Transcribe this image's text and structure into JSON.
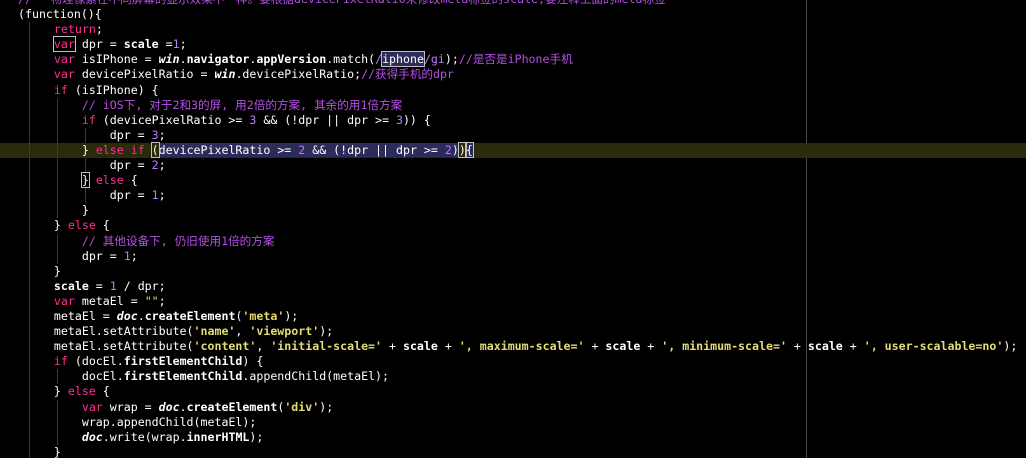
{
  "editor": {
    "lines": [
      {
        "tokens": [
          {
            "t": "// 一物理像素在不同屏幕的显示效果不一样。要根据devicePixelRatio来修改meta标签的scale,要注释上面的meta标签",
            "c": "comment"
          }
        ]
      },
      {
        "tokens": [
          {
            "t": "(function(){",
            "c": "plain"
          }
        ]
      },
      {
        "tokens": [
          {
            "t": "    ",
            "c": "plain"
          },
          {
            "t": "return",
            "c": "keyword"
          },
          {
            "t": ";",
            "c": "plain"
          }
        ]
      },
      {
        "tokens": [
          {
            "t": "    ",
            "c": "plain"
          },
          {
            "t": "var",
            "c": "keyword mark"
          },
          {
            "t": " dpr = ",
            "c": "plain"
          },
          {
            "t": "scale",
            "c": "plain bold"
          },
          {
            "t": " =",
            "c": "plain"
          },
          {
            "t": "1",
            "c": "number"
          },
          {
            "t": ";",
            "c": "plain"
          }
        ]
      },
      {
        "tokens": [
          {
            "t": "    ",
            "c": "plain"
          },
          {
            "t": "var",
            "c": "keyword"
          },
          {
            "t": " isIPhone = ",
            "c": "plain"
          },
          {
            "t": "win",
            "c": "plain bold italic"
          },
          {
            "t": ".",
            "c": "plain"
          },
          {
            "t": "navigator",
            "c": "plain bold"
          },
          {
            "t": ".",
            "c": "plain"
          },
          {
            "t": "appVersion",
            "c": "plain bold"
          },
          {
            "t": ".match(",
            "c": "plain"
          },
          {
            "t": "/",
            "c": "number"
          },
          {
            "t": "iphone",
            "c": "plain cursorbox"
          },
          {
            "t": "/gi",
            "c": "number"
          },
          {
            "t": ");",
            "c": "plain"
          },
          {
            "t": "//是否是iPhone手机",
            "c": "comment"
          }
        ]
      },
      {
        "tokens": [
          {
            "t": "    ",
            "c": "plain"
          },
          {
            "t": "var",
            "c": "keyword"
          },
          {
            "t": " devicePixelRatio = ",
            "c": "plain"
          },
          {
            "t": "win",
            "c": "plain bold italic"
          },
          {
            "t": ".devicePixelRatio;",
            "c": "plain"
          },
          {
            "t": "//获得手机的dpr",
            "c": "comment"
          }
        ]
      },
      {
        "tokens": [
          {
            "t": "    ",
            "c": "plain"
          },
          {
            "t": "if",
            "c": "keyword"
          },
          {
            "t": " (isIPhone) {",
            "c": "plain"
          }
        ]
      },
      {
        "tokens": [
          {
            "t": "        ",
            "c": "plain"
          },
          {
            "t": "// iOS下, 对于2和3的屏, 用2倍的方案, 其余的用1倍方案",
            "c": "comment"
          }
        ]
      },
      {
        "tokens": [
          {
            "t": "        ",
            "c": "plain"
          },
          {
            "t": "if",
            "c": "keyword"
          },
          {
            "t": " (devicePixelRatio >= ",
            "c": "plain"
          },
          {
            "t": "3",
            "c": "number"
          },
          {
            "t": " && (!dpr || dpr >= ",
            "c": "plain"
          },
          {
            "t": "3",
            "c": "number"
          },
          {
            "t": ")) {",
            "c": "plain"
          }
        ]
      },
      {
        "tokens": [
          {
            "t": "            dpr = ",
            "c": "plain"
          },
          {
            "t": "3",
            "c": "number"
          },
          {
            "t": ";",
            "c": "plain"
          }
        ]
      },
      {
        "current": true,
        "tokens": [
          {
            "t": "        } ",
            "c": "plain"
          },
          {
            "t": "else",
            "c": "keyword"
          },
          {
            "t": " ",
            "c": "plain"
          },
          {
            "t": "if",
            "c": "keyword"
          },
          {
            "t": " ",
            "c": "plain"
          },
          {
            "t": "(",
            "c": "plain mark"
          },
          {
            "t": "devicePixelRatio >= ",
            "c": "plain selected"
          },
          {
            "t": "2",
            "c": "number selected"
          },
          {
            "t": " && (!dpr || dpr >= ",
            "c": "plain selected"
          },
          {
            "t": "2",
            "c": "number selected"
          },
          {
            "t": ")",
            "c": "plain selected"
          },
          {
            "t": ")",
            "c": "plain mark"
          },
          {
            "t": "{",
            "c": "plain cursorbox"
          }
        ]
      },
      {
        "tokens": [
          {
            "t": "            dpr = ",
            "c": "plain"
          },
          {
            "t": "2",
            "c": "number"
          },
          {
            "t": ";",
            "c": "plain"
          }
        ]
      },
      {
        "tokens": [
          {
            "t": "        ",
            "c": "plain"
          },
          {
            "t": "}",
            "c": "plain mark"
          },
          {
            "t": " ",
            "c": "plain"
          },
          {
            "t": "else",
            "c": "keyword"
          },
          {
            "t": " {",
            "c": "plain"
          }
        ]
      },
      {
        "tokens": [
          {
            "t": "            dpr = ",
            "c": "plain"
          },
          {
            "t": "1",
            "c": "number"
          },
          {
            "t": ";",
            "c": "plain"
          }
        ]
      },
      {
        "tokens": [
          {
            "t": "        }",
            "c": "plain"
          }
        ]
      },
      {
        "tokens": [
          {
            "t": "    } ",
            "c": "plain"
          },
          {
            "t": "else",
            "c": "keyword"
          },
          {
            "t": " {",
            "c": "plain"
          }
        ]
      },
      {
        "tokens": [
          {
            "t": "        ",
            "c": "plain"
          },
          {
            "t": "// 其他设备下, 仍旧使用1倍的方案",
            "c": "comment"
          }
        ]
      },
      {
        "tokens": [
          {
            "t": "        dpr = ",
            "c": "plain"
          },
          {
            "t": "1",
            "c": "number"
          },
          {
            "t": ";",
            "c": "plain"
          }
        ]
      },
      {
        "tokens": [
          {
            "t": "    }",
            "c": "plain"
          }
        ]
      },
      {
        "tokens": [
          {
            "t": "    ",
            "c": "plain"
          },
          {
            "t": "scale",
            "c": "plain bold"
          },
          {
            "t": " = ",
            "c": "plain"
          },
          {
            "t": "1",
            "c": "number"
          },
          {
            "t": " / dpr;",
            "c": "plain"
          }
        ]
      },
      {
        "tokens": [
          {
            "t": "    ",
            "c": "plain"
          },
          {
            "t": "var",
            "c": "keyword"
          },
          {
            "t": " metaEl = ",
            "c": "plain"
          },
          {
            "t": "\"\"",
            "c": "string"
          },
          {
            "t": ";",
            "c": "plain"
          }
        ]
      },
      {
        "tokens": [
          {
            "t": "    metaEl = ",
            "c": "plain"
          },
          {
            "t": "doc",
            "c": "plain bold italic"
          },
          {
            "t": ".",
            "c": "plain"
          },
          {
            "t": "createElement",
            "c": "plain bold"
          },
          {
            "t": "(",
            "c": "plain"
          },
          {
            "t": "'meta'",
            "c": "string bold"
          },
          {
            "t": ");",
            "c": "plain"
          }
        ]
      },
      {
        "tokens": [
          {
            "t": "    metaEl.",
            "c": "plain"
          },
          {
            "t": "setAttribute",
            "c": "plain"
          },
          {
            "t": "(",
            "c": "plain"
          },
          {
            "t": "'name'",
            "c": "string bold"
          },
          {
            "t": ", ",
            "c": "plain"
          },
          {
            "t": "'viewport'",
            "c": "string bold"
          },
          {
            "t": ");",
            "c": "plain"
          }
        ]
      },
      {
        "tokens": [
          {
            "t": "    metaEl.",
            "c": "plain"
          },
          {
            "t": "setAttribute",
            "c": "plain"
          },
          {
            "t": "(",
            "c": "plain"
          },
          {
            "t": "'content'",
            "c": "string bold"
          },
          {
            "t": ", ",
            "c": "plain"
          },
          {
            "t": "'initial-scale='",
            "c": "string bold"
          },
          {
            "t": " + ",
            "c": "plain"
          },
          {
            "t": "scale",
            "c": "plain bold"
          },
          {
            "t": " + ",
            "c": "plain"
          },
          {
            "t": "', maximum-scale='",
            "c": "string bold"
          },
          {
            "t": " + ",
            "c": "plain"
          },
          {
            "t": "scale",
            "c": "plain bold"
          },
          {
            "t": " + ",
            "c": "plain"
          },
          {
            "t": "', minimum-scale='",
            "c": "string bold"
          },
          {
            "t": " + ",
            "c": "plain"
          },
          {
            "t": "scale",
            "c": "plain bold"
          },
          {
            "t": " + ",
            "c": "plain"
          },
          {
            "t": "', user-scalable=no'",
            "c": "string bold"
          },
          {
            "t": ");",
            "c": "plain"
          }
        ]
      },
      {
        "tokens": [
          {
            "t": "    ",
            "c": "plain"
          },
          {
            "t": "if",
            "c": "keyword"
          },
          {
            "t": " (docEl.",
            "c": "plain"
          },
          {
            "t": "firstElementChild",
            "c": "plain bold"
          },
          {
            "t": ") {",
            "c": "plain"
          }
        ]
      },
      {
        "tokens": [
          {
            "t": "        docEl.",
            "c": "plain"
          },
          {
            "t": "firstElementChild",
            "c": "plain bold"
          },
          {
            "t": ".",
            "c": "plain"
          },
          {
            "t": "appendChild",
            "c": "plain"
          },
          {
            "t": "(metaEl);",
            "c": "plain"
          }
        ]
      },
      {
        "tokens": [
          {
            "t": "    } ",
            "c": "plain"
          },
          {
            "t": "else",
            "c": "keyword"
          },
          {
            "t": " {",
            "c": "plain"
          }
        ]
      },
      {
        "tokens": [
          {
            "t": "        ",
            "c": "plain"
          },
          {
            "t": "var",
            "c": "keyword"
          },
          {
            "t": " wrap = ",
            "c": "plain"
          },
          {
            "t": "doc",
            "c": "plain bold italic"
          },
          {
            "t": ".",
            "c": "plain"
          },
          {
            "t": "createElement",
            "c": "plain bold"
          },
          {
            "t": "(",
            "c": "plain"
          },
          {
            "t": "'div'",
            "c": "string bold"
          },
          {
            "t": ");",
            "c": "plain"
          }
        ]
      },
      {
        "tokens": [
          {
            "t": "        wrap.",
            "c": "plain"
          },
          {
            "t": "appendChild",
            "c": "plain"
          },
          {
            "t": "(metaEl);",
            "c": "plain"
          }
        ]
      },
      {
        "tokens": [
          {
            "t": "        ",
            "c": "plain"
          },
          {
            "t": "doc",
            "c": "plain bold italic"
          },
          {
            "t": ".",
            "c": "plain"
          },
          {
            "t": "write",
            "c": "plain"
          },
          {
            "t": "(wrap.",
            "c": "plain"
          },
          {
            "t": "innerHTML",
            "c": "plain bold"
          },
          {
            "t": ");",
            "c": "plain"
          }
        ]
      },
      {
        "tokens": [
          {
            "t": "    }",
            "c": "plain"
          }
        ]
      }
    ]
  }
}
